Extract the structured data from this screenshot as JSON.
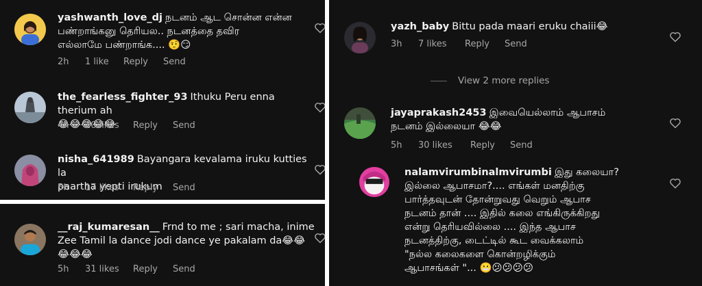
{
  "colors": {
    "background": "#121212",
    "text": "#f2f2f2",
    "muted": "#a8a8a8"
  },
  "top_left": {
    "comments": [
      {
        "username": "yashwanth_love_dj",
        "text_line1": "நடனம் ஆட சொன்ன என்ன",
        "text_line2": "பண்றாங்கனு தெரியல.. நடனத்தை தவிர",
        "text_line3": "எல்லாமே பண்றாங்க.... 🤨😏",
        "time": "2h",
        "likes": "1 like",
        "reply": "Reply",
        "send": "Send",
        "avatar_icon": "avatar-girl-yellow-icon"
      },
      {
        "username": "the_fearless_fighter_93",
        "text_line1": "Ithuku Peru enna therium ah",
        "text_line2": "😂😂😂😂😂",
        "time": "4h",
        "likes": "10 likes",
        "reply": "Reply",
        "send": "Send",
        "avatar_icon": "avatar-statue-icon"
      },
      {
        "username": "nisha_641989",
        "text_line1": "Bayangara kevalama iruku kutties la",
        "text_line2": "paartha yepti irukum",
        "time": "5h",
        "likes": "17 likes",
        "reply": "Reply",
        "send": "Send",
        "avatar_icon": "avatar-pink-hood-icon"
      }
    ]
  },
  "bottom_left": {
    "comments": [
      {
        "username": "__raj_kumaresan__",
        "text_line1": "Frnd to me ; sari macha, inime",
        "text_line2": "Zee Tamil la dance jodi dance ye pakalam da😂😂",
        "text_line3": "😂😂😂",
        "time": "5h",
        "likes": "31 likes",
        "reply": "Reply",
        "send": "Send",
        "avatar_icon": "avatar-man-icon"
      }
    ]
  },
  "right": {
    "comments": [
      {
        "username": "yazh_baby",
        "text_line1": "Bittu pada maari eruku chaiii😂",
        "time": "3h",
        "likes": "7 likes",
        "reply": "Reply",
        "send": "Send",
        "avatar_icon": "avatar-woman-dark-icon"
      },
      {
        "username": "jayaprakash2453",
        "text_line1": "இவையெல்லாம் ஆபாசம்",
        "text_line2": "நடனம் இல்லையா 😂😂",
        "time": "5h",
        "likes": "30 likes",
        "reply": "Reply",
        "send": "Send",
        "avatar_icon": "avatar-landscape-icon"
      },
      {
        "username": "nalamvirumbinalmvirumbi",
        "text_line1": "இது கலையா?",
        "text_line2": "இல்லை ஆபாசமா?.... எங்கள் மனதிற்கு",
        "text_line3": "பார்த்தவுடன் தோன்றுவது வெறும் ஆபாச",
        "text_line4": "நடனம் தான் .... இதில் கலை எங்கிருக்கிறது",
        "text_line5": "என்று தெரியவில்லை .... இந்த ஆபாச",
        "text_line6": "நடனத்திற்கு, டைட்டில் கூட வைக்கலாம்",
        "text_line7": "\"நல்ல கலைகளை  கொன்றழிக்கும்",
        "text_line8": "ஆபாசங்கள் \"... 😬😕😕😕😕",
        "avatar_icon": "avatar-pink-masked-icon"
      }
    ],
    "view_more": "View 2 more replies"
  }
}
